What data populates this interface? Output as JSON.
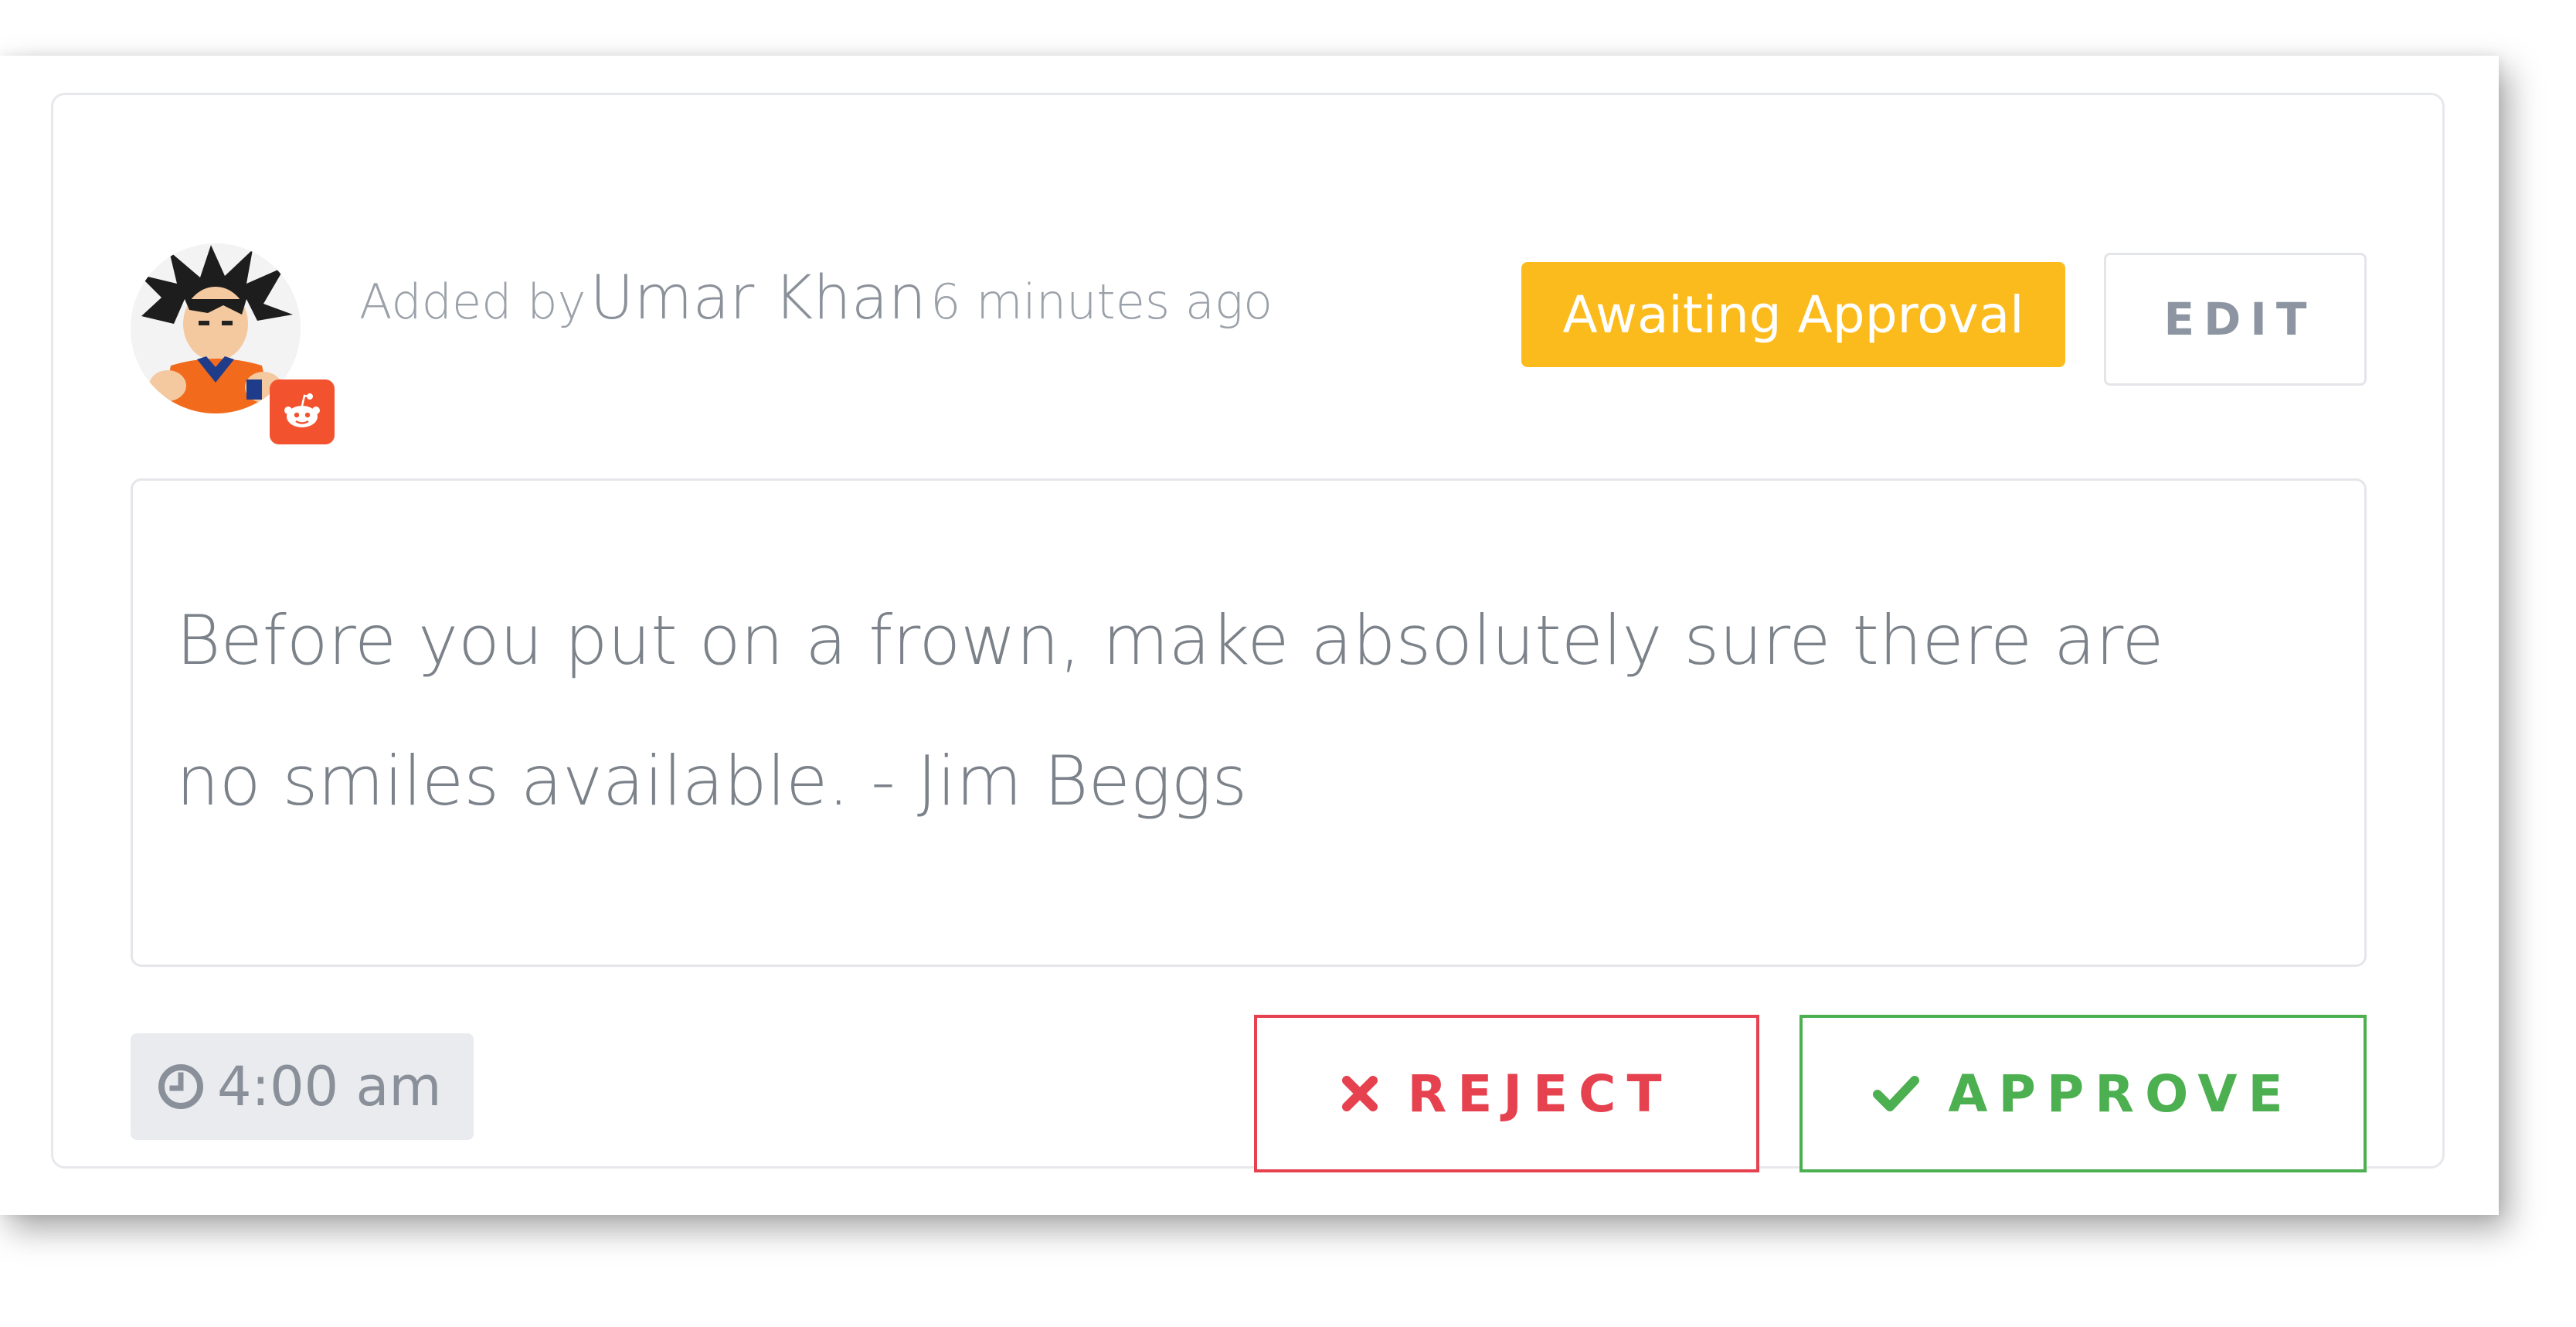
{
  "post": {
    "added_by_prefix": "Added by",
    "author_name": "Umar Khan",
    "time_ago": "6 minutes ago",
    "status": "Awaiting Approval",
    "content": "Before you put on a frown, make absolutely sure there are no smiles available. - Jim Beggs",
    "scheduled_time": "4:00 am",
    "platform": "reddit"
  },
  "actions": {
    "edit_label": "EDIT",
    "reject_label": "REJECT",
    "approve_label": "APPROVE"
  },
  "icons": {
    "platform_badge": "reddit-icon",
    "time": "clock-icon",
    "reject": "times-icon",
    "approve": "check-icon"
  },
  "colors": {
    "status_badge": "#fcbb1c",
    "platform_badge": "#f2522e",
    "reject": "#e6414f",
    "approve": "#4caf50",
    "time_chip_bg": "#e9ebee"
  }
}
